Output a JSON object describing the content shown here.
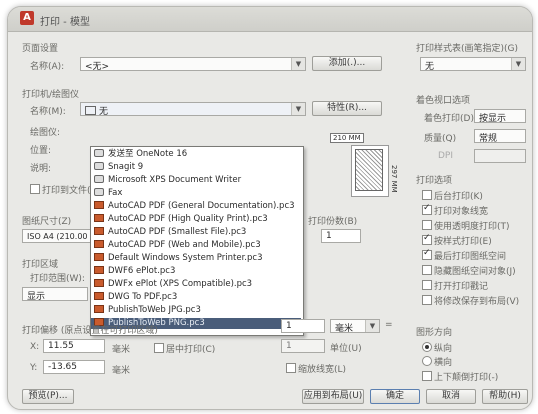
{
  "window": {
    "title": "打印 - 模型"
  },
  "page_setup": {
    "group_label": "页面设置",
    "name_label": "名称(A):",
    "name_value": "<无>",
    "add_button": "添加(.)..."
  },
  "printer": {
    "group_label": "打印机/绘图仪",
    "name_label": "名称(M):",
    "name_value": "无",
    "properties_button": "特性(R)...",
    "plotter_label": "绘图仪:",
    "location_label": "位置:",
    "description_label": "说明:",
    "print_to_file": "打印到文件(F)",
    "dropdown_items": [
      {
        "label": "发送至 OneNote 16",
        "icon": "printer-icon"
      },
      {
        "label": "Snagit 9",
        "icon": "printer-icon"
      },
      {
        "label": "Microsoft XPS Document Writer",
        "icon": "printer-icon"
      },
      {
        "label": "Fax",
        "icon": "printer-icon"
      },
      {
        "label": "AutoCAD PDF (General Documentation).pc3",
        "icon": "plotter-icon"
      },
      {
        "label": "AutoCAD PDF (High Quality Print).pc3",
        "icon": "plotter-icon"
      },
      {
        "label": "AutoCAD PDF (Smallest File).pc3",
        "icon": "plotter-icon"
      },
      {
        "label": "AutoCAD PDF (Web and Mobile).pc3",
        "icon": "plotter-icon"
      },
      {
        "label": "Default Windows System Printer.pc3",
        "icon": "plotter-icon"
      },
      {
        "label": "DWF6 ePlot.pc3",
        "icon": "plotter-icon"
      },
      {
        "label": "DWFx ePlot (XPS Compatible).pc3",
        "icon": "plotter-icon"
      },
      {
        "label": "DWG To PDF.pc3",
        "icon": "plotter-icon"
      },
      {
        "label": "PublishToWeb JPG.pc3",
        "icon": "plotter-icon"
      },
      {
        "label": "PublishToWeb PNG.pc3",
        "icon": "plotter-icon"
      }
    ],
    "selected_index": 13
  },
  "paper_preview": {
    "width_label": "210 MM",
    "height_label": "297 MM"
  },
  "paper_size": {
    "label": "图纸尺寸(Z)",
    "value": "ISO A4 (210.00 x 297.00 毫米)"
  },
  "copies": {
    "label": "打印份数(B)",
    "value": "1"
  },
  "plot_area": {
    "group_label": "打印区域",
    "what_label": "打印范围(W):",
    "value": "显示"
  },
  "plot_scale": {
    "value1": "1",
    "unit": "毫米",
    "value2": "1",
    "unit2": "单位(U)",
    "scale_lineweights": "缩放线宽(L)"
  },
  "plot_offset": {
    "group_label": "打印偏移 (原点设置在可打印区域)",
    "x_label": "X:",
    "x_value": "11.55",
    "x_unit": "毫米",
    "y_label": "Y:",
    "y_value": "-13.65",
    "y_unit": "毫米",
    "center_plot": "居中打印(C)"
  },
  "plot_style_table": {
    "group_label": "打印样式表(画笔指定)(G)",
    "value": "无"
  },
  "shaded_viewport": {
    "group_label": "着色视口选项",
    "shade_label": "着色打印(D)",
    "shade_value": "按显示",
    "quality_label": "质量(Q)",
    "quality_value": "常规",
    "dpi_label": "DPI"
  },
  "plot_options": {
    "group_label": "打印选项",
    "items": [
      {
        "label": "后台打印(K)",
        "checked": false
      },
      {
        "label": "打印对象线宽",
        "checked": true
      },
      {
        "label": "使用透明度打印(T)",
        "checked": false
      },
      {
        "label": "按样式打印(E)",
        "checked": true
      },
      {
        "label": "最后打印图纸空间",
        "checked": true
      },
      {
        "label": "隐藏图纸空间对象(J)",
        "checked": false
      },
      {
        "label": "打开打印戳记",
        "checked": false
      },
      {
        "label": "将修改保存到布局(V)",
        "checked": false
      }
    ]
  },
  "orientation": {
    "group_label": "图形方向",
    "portrait": "纵向",
    "landscape": "横向",
    "upside_down": "上下颠倒打印(-)",
    "selected": "portrait"
  },
  "footer": {
    "preview_button": "预览(P)...",
    "apply_button": "应用到布局(U)",
    "ok_button": "确定",
    "cancel_button": "取消",
    "help_button": "帮助(H)"
  },
  "colors": {
    "selection": "#4a5d7a",
    "window_bg": "#e9e9e6"
  }
}
